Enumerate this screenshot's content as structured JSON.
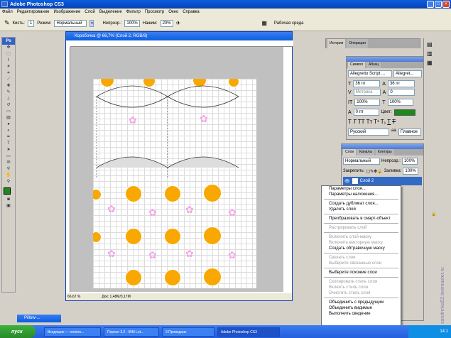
{
  "window": {
    "title": "Adobe Photoshop CS3"
  },
  "menu": [
    "Файл",
    "Редактирование",
    "Изображение",
    "Слой",
    "Выделение",
    "Фильтр",
    "Просмотр",
    "Окно",
    "Справка"
  ],
  "options": {
    "brush_label": "Кисть:",
    "brush_size": "1",
    "mode_label": "Режим:",
    "mode_value": "Нормальный",
    "opacity_label": "Непрозр.:",
    "opacity_value": "100%",
    "flow_label": "Нажим:",
    "flow_value": "20%",
    "workspace_label": "Рабочая среда"
  },
  "document": {
    "title": "Коробочка @ 66,7% (Слой 2, RGB/8)",
    "zoom": "66,67 %",
    "doc_info": "Док: 1,48M/3,17M"
  },
  "history_panel": {
    "tabs": [
      "История",
      "Операции"
    ]
  },
  "char_panel": {
    "tabs": [
      "Символ",
      "Абзац"
    ],
    "font": "Allegretto Script ...",
    "font_style": "Allegret...",
    "size": "36 пт",
    "leading": "36 пт",
    "kerning": "Метрика",
    "tracking": "0",
    "vscale": "100%",
    "hscale": "100%",
    "baseline": "0 пт",
    "color_label": "Цвет:",
    "language": "Русский",
    "aa": "Плавное"
  },
  "layers_panel": {
    "tabs": [
      "Слои",
      "Каналы",
      "Контуры"
    ],
    "blend": "Нормальный",
    "opacity_label": "Непрозр.:",
    "opacity_value": "100%",
    "lock_label": "Закрепить:",
    "fill_label": "Заливка:",
    "fill_value": "100%",
    "selected_layer": "Слой 2"
  },
  "context_menu": {
    "groups": [
      [
        {
          "label": "Параметры слоя...",
          "enabled": true
        },
        {
          "label": "Параметры наложения...",
          "enabled": true
        }
      ],
      [
        {
          "label": "Создать дубликат слоя...",
          "enabled": true
        },
        {
          "label": "Удалить слой",
          "enabled": true
        }
      ],
      [
        {
          "label": "Преобразовать в смарт-объект",
          "enabled": true
        }
      ],
      [
        {
          "label": "Растрировать слой",
          "enabled": false
        }
      ],
      [
        {
          "label": "Включить слой-маску",
          "enabled": false
        },
        {
          "label": "Включить векторную маску",
          "enabled": false
        },
        {
          "label": "Создать обтравочную маску",
          "enabled": true
        }
      ],
      [
        {
          "label": "Связать слои",
          "enabled": false
        },
        {
          "label": "Выберите связанные слои",
          "enabled": false
        }
      ],
      [
        {
          "label": "Выберите похожие слои",
          "enabled": true
        }
      ],
      [
        {
          "label": "Скопировать стиль слоя",
          "enabled": false
        },
        {
          "label": "Вклеить стиль слоя",
          "enabled": false
        },
        {
          "label": "Очистить стиль слоя",
          "enabled": false
        }
      ],
      [
        {
          "label": "Объединить с предыдущим",
          "enabled": true
        },
        {
          "label": "Объединить видимые",
          "enabled": true
        },
        {
          "label": "Выполнить сведение",
          "enabled": true
        }
      ]
    ]
  },
  "minimized_doc": {
    "label": "Pillow-..."
  },
  "taskbar": {
    "start_label": "пуск",
    "items": [
      "Входящие — rectorn...",
      "Портал 3.2 - IBM Lot...",
      "3 Проводник",
      "Adobe Photoshop CS3"
    ],
    "clock": "14:1"
  },
  "watermark": "sandrinka52.livemaster.ru",
  "colors": {
    "accent": "#0a5fe0",
    "orange": "#f8a800",
    "pink": "#f3a8e8",
    "swatch_green": "#1a8a1a"
  }
}
